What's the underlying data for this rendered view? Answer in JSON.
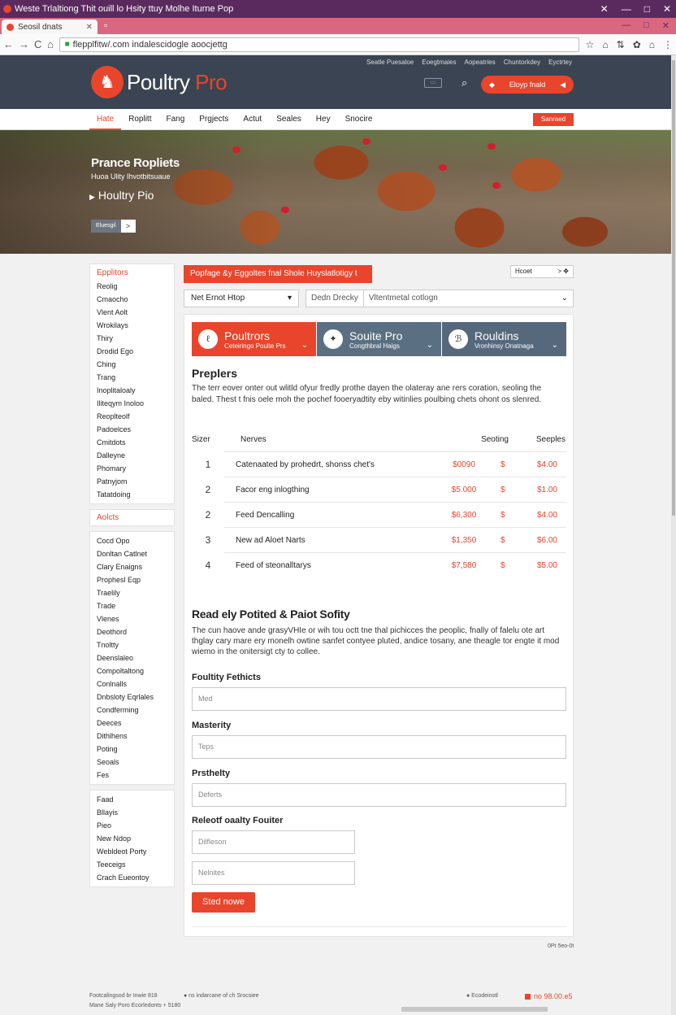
{
  "window": {
    "title": "Weste Trlaltiong Thit ouill lo Hsity ttuy Molhe Iturne Pop",
    "controls": [
      "✕",
      "—",
      "□",
      "✕"
    ]
  },
  "tabs": [
    {
      "label": "Seosil dnats",
      "close": "✕"
    }
  ],
  "browser": {
    "url": "flepplfitw/.com indalescidogle aoocjettg",
    "back": "←",
    "forward": "→",
    "reload": "C",
    "home": "⌂",
    "tool_icons": [
      "☆",
      "⌂",
      "⇅",
      "✿",
      "⌂",
      "⋮"
    ]
  },
  "header": {
    "logo_text": "Poultry",
    "logo_accent": "Pro",
    "top_links": [
      "Seatle Puesaloe",
      "Eoegtmaies",
      "Aopeatries",
      "Chuntorkdey",
      "Eyctrtey"
    ],
    "search_icon": "⌕",
    "cta_label": "Eloyp fnald",
    "cta_icon": "◀"
  },
  "nav": {
    "items": [
      "Hate",
      "Roplitt",
      "Fang",
      "Prgjects",
      "Actut",
      "Seales",
      "Hey",
      "Snocire"
    ],
    "active_index": 0,
    "button": "Sanraed"
  },
  "hero": {
    "title": "Prance Ropliets",
    "subtitle": "Huoa Ulity Ihvotbitsuaue",
    "brand": "Houltry Pio",
    "brand_icon": "▶",
    "button_label": "Eluesgil",
    "button_arrow": ">"
  },
  "sidebar": {
    "groups": [
      {
        "heading": "Epplitors",
        "items": [
          "Reolig",
          "Cmaocho",
          "Vlent Aolt",
          "Wrokilays",
          "Thiry",
          "Drodid Ego",
          "Ching",
          "Trang",
          "Inoplitaloaly",
          "Iliteqym Inoloo",
          "Reoplteolf",
          "Padoelces",
          "Cmitdots",
          "Dalleyne",
          "Phomary",
          "Patnyjom",
          "Tatatdoing"
        ]
      },
      {
        "heading": "Aolcts",
        "active": true,
        "items": []
      },
      {
        "heading": "",
        "items": [
          "Cocd Opo",
          "Donltan Catlnet",
          "Clary Enaigns",
          "Prophesl Eqp",
          "Traelily",
          "Trade",
          "Vlenes",
          "Deothord",
          "Tnoltty",
          "Deenslaleo",
          "Compoltaltong",
          "Conlnalls",
          "Dnbsloty Eqrlales",
          "Condferming",
          "Deeces",
          "Dithlhens",
          "Poting",
          "Seoals",
          "Fes"
        ]
      },
      {
        "heading": "",
        "items": [
          "Faad",
          "Bllayis",
          "Pieo",
          "New Ndop",
          "Webldeot Porty",
          "Teeceigs",
          "Crach Eueontoy"
        ]
      }
    ]
  },
  "main": {
    "banner": "Popfage &y Eggoltes fnal Shole Huyslatlotigy t",
    "pager": {
      "label": "Hcoet",
      "arrow": ">",
      "icon": "✥"
    },
    "filter1": {
      "label": "Net Ernot Htop",
      "arrow": "▾"
    },
    "filter2": {
      "part1": "Dedn Drecky",
      "part2": "Vltentmetal cotlogn",
      "arrow": "⌄"
    },
    "categories": [
      {
        "title": "Poultrors",
        "subtitle": "Ceteiringo Poulte Prs",
        "icon": "ℓ",
        "chevron": "⌄"
      },
      {
        "title": "Souite Pro",
        "subtitle": "Congthbral Haigs",
        "icon": "✦",
        "chevron": "⌄"
      },
      {
        "title": "Rouldins",
        "subtitle": "Vronhinsy Onatnaga",
        "icon": "ℬ",
        "chevron": "⌄"
      }
    ],
    "section_title": "Preplers",
    "section_desc": "The terr eover onter out wlitld ofyur fredly prothe dayen the olateray ane rers coration, seoling the baled. Thest t fnis oele moh the pochef fooeryadtity eby witinlies poulbing chets ohont os slenred.",
    "table": {
      "headers": [
        "Sizer",
        "Nerves",
        "Seoting",
        "Seeples"
      ],
      "rows": [
        {
          "num": "1",
          "name": "Catenaated by prohedrt, shonss chet's",
          "price": "$0090",
          "cur": "$",
          "fee": "$4.00"
        },
        {
          "num": "2",
          "name": "Facor eng inlogthing",
          "price": "$5.000",
          "cur": "$",
          "fee": "$1.00"
        },
        {
          "num": "2",
          "name": "Feed Dencalling",
          "price": "$6,300",
          "cur": "$",
          "fee": "$4.00"
        },
        {
          "num": "3",
          "name": "New ad Aloet Narts",
          "price": "$1,350",
          "cur": "$",
          "fee": "$6.00"
        },
        {
          "num": "4",
          "name": "Feed of steonalltarys",
          "price": "$7,580",
          "cur": "$",
          "fee": "$5.00"
        }
      ]
    },
    "section2_title": "Read ely Potited & Paiot Sofity",
    "section2_desc": "The cun haove ande grasyVHIe or wih tou octt tne thal pichicces the peoplic, fnally of falelu ote art thglay cary mare ery monelh owtine sanfet contyee pluted, andice tosany, ane theagle tor engte it mod wiemo in the onitersigt cty to collee.",
    "form": [
      {
        "label": "Foultity Fethicts",
        "placeholder": "Med"
      },
      {
        "label": "Masterity",
        "placeholder": "Teps"
      },
      {
        "label": "Prsthelty",
        "placeholder": "Deferts"
      },
      {
        "label": "Releotf oaalty Fouiter",
        "placeholder": "Dilfleson"
      },
      {
        "label": "",
        "placeholder": "Nelnites"
      }
    ],
    "submit": "Sted nowe"
  },
  "small_note": "0Pt 5eo-0t",
  "footer": {
    "left1": "Footcalingsod br Inwie 818",
    "left1b": "● ns indarcane of ch Srocsiee",
    "left2": "Mane Saly Poro Ecorledonts + 5180",
    "right1": "● Ecodeinotl",
    "right2": "no 98.00.e5"
  },
  "colors": {
    "accent": "#e8452c",
    "header_bg": "#3a4452",
    "titlebar": "#5a2a5f",
    "tabbar": "#d9677f"
  }
}
